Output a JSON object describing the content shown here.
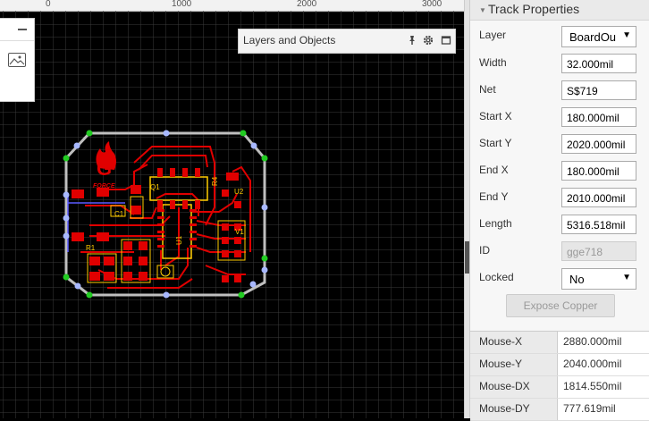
{
  "ruler": {
    "labels": [
      "0",
      "1000",
      "2000",
      "3000"
    ]
  },
  "drawing_tools": {
    "collapse_icon": "minus-icon",
    "image_icon": "image-icon"
  },
  "layers_panel": {
    "title": "Layers and Objects",
    "icons": [
      "pin-icon",
      "gear-icon",
      "maximize-icon"
    ]
  },
  "pcb": {
    "logo_text": "FORCE",
    "labels": [
      "R4",
      "U2",
      "U1",
      "V1",
      "C1",
      "R1",
      "Q1"
    ]
  },
  "track_properties": {
    "title": "Track Properties",
    "fields": [
      {
        "label": "Layer",
        "value": "BoardOu",
        "type": "select"
      },
      {
        "label": "Width",
        "value": "32.000mil"
      },
      {
        "label": "Net",
        "value": "S$719"
      },
      {
        "label": "Start X",
        "value": "180.000mil"
      },
      {
        "label": "Start Y",
        "value": "2020.000mil"
      },
      {
        "label": "End X",
        "value": "180.000mil"
      },
      {
        "label": "End Y",
        "value": "2010.000mil"
      },
      {
        "label": "Length",
        "value": "5316.518mil"
      },
      {
        "label": "ID",
        "value": "gge718",
        "disabled": true
      },
      {
        "label": "Locked",
        "value": "No",
        "type": "select"
      }
    ],
    "expose_button": "Expose Copper"
  },
  "mouse_info": [
    {
      "label": "Mouse-X",
      "value": "2880.000mil"
    },
    {
      "label": "Mouse-Y",
      "value": "2040.000mil"
    },
    {
      "label": "Mouse-DX",
      "value": "1814.550mil"
    },
    {
      "label": "Mouse-DY",
      "value": "777.619mil"
    }
  ],
  "colors": {
    "canvas": "#000000",
    "grid": "#3a3a3a",
    "copper": "#e00000",
    "silkscreen": "#ffcc00",
    "outline": "#bfbfbf",
    "handle_green": "#22cc22",
    "handle_blue": "#a8b8ff"
  }
}
